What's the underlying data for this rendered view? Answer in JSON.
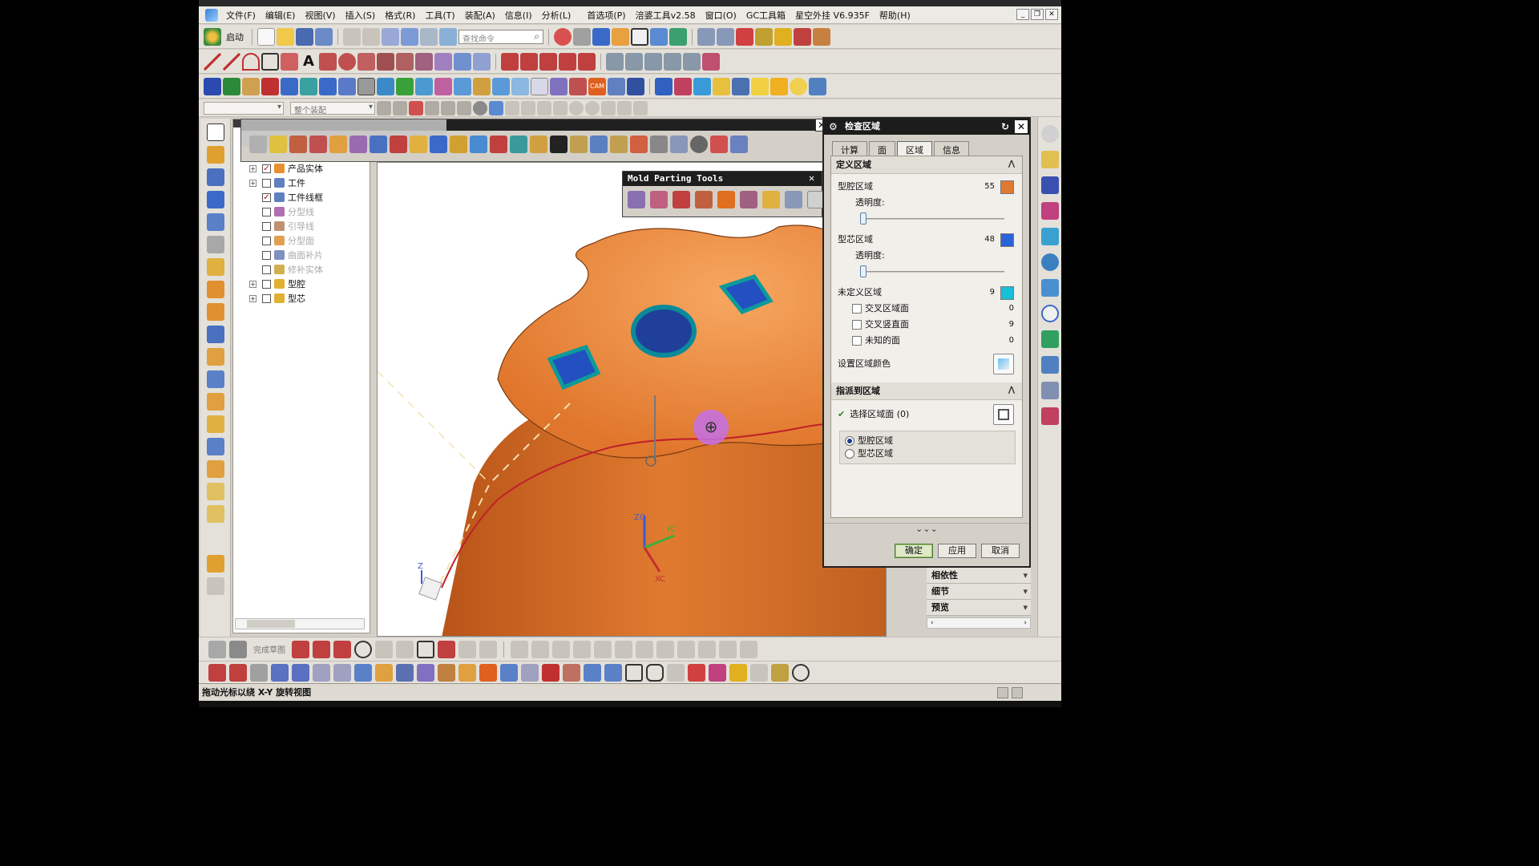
{
  "menu": [
    "文件(F)",
    "编辑(E)",
    "视图(V)",
    "插入(S)",
    "格式(R)",
    "工具(T)",
    "装配(A)",
    "信息(I)",
    "分析(L)",
    "首选项(P)",
    "涪婆工具v2.58",
    "窗口(O)",
    "GC工具箱",
    "星空外挂 V6.935F",
    "帮助(H)"
  ],
  "toolbar": {
    "start_label": "启动",
    "search_placeholder": "查找命令",
    "combo1": "",
    "combo2": "整个装配"
  },
  "tree": [
    {
      "label": "产品实体",
      "checked": true,
      "exp": "+",
      "dim": false,
      "color": "#e89030"
    },
    {
      "label": "工件",
      "checked": false,
      "exp": "+",
      "dim": false,
      "color": "#6080c0"
    },
    {
      "label": "工件线框",
      "checked": true,
      "exp": "",
      "dim": false,
      "color": "#6080c0"
    },
    {
      "label": "分型线",
      "checked": false,
      "exp": "",
      "dim": true,
      "color": "#b070b0"
    },
    {
      "label": "引导线",
      "checked": false,
      "exp": "",
      "dim": true,
      "color": "#c09070"
    },
    {
      "label": "分型面",
      "checked": false,
      "exp": "",
      "dim": true,
      "color": "#e0a050"
    },
    {
      "label": "曲面补片",
      "checked": false,
      "exp": "",
      "dim": true,
      "color": "#8090c0"
    },
    {
      "label": "修补实体",
      "checked": false,
      "exp": "",
      "dim": true,
      "color": "#d0b050"
    },
    {
      "label": "型腔",
      "checked": false,
      "exp": "+",
      "dim": false,
      "color": "#e0b030"
    },
    {
      "label": "型芯",
      "checked": false,
      "exp": "+",
      "dim": false,
      "color": "#e0b030"
    }
  ],
  "mold_tools": {
    "title": "Mold Parting Tools"
  },
  "dialog": {
    "title": "检查区域",
    "tabs": [
      "计算",
      "面",
      "区域",
      "信息"
    ],
    "define_section": "定义区域",
    "cavity": {
      "label": "型腔区域",
      "count": "55",
      "color": "#e07a32",
      "transparency": "透明度:"
    },
    "core": {
      "label": "型芯区域",
      "count": "48",
      "color": "#2a62d8",
      "transparency": "透明度:"
    },
    "undefined": {
      "label": "未定义区域",
      "count": "9",
      "color": "#19bfd8"
    },
    "checks": [
      {
        "label": "交叉区域面",
        "count": "0"
      },
      {
        "label": "交叉竖直面",
        "count": "9"
      },
      {
        "label": "未知的面",
        "count": "0"
      }
    ],
    "set_color": "设置区域颜色",
    "assign_section": "指派到区域",
    "select_faces": "选择区域面 (0)",
    "radios": [
      {
        "label": "型腔区域",
        "on": true
      },
      {
        "label": "型芯区域",
        "on": false
      }
    ],
    "ok": "确定",
    "apply": "应用",
    "cancel": "取消"
  },
  "side_panels": [
    "相依性",
    "细节",
    "预览"
  ],
  "bottom": {
    "finish_sketch": "完成草图"
  },
  "status_text": "拖动光标以绕 X-Y 旋转视图",
  "axis_labels": {
    "zc": "ZC",
    "yc": "YC",
    "xc": "XC",
    "z": "Z"
  }
}
